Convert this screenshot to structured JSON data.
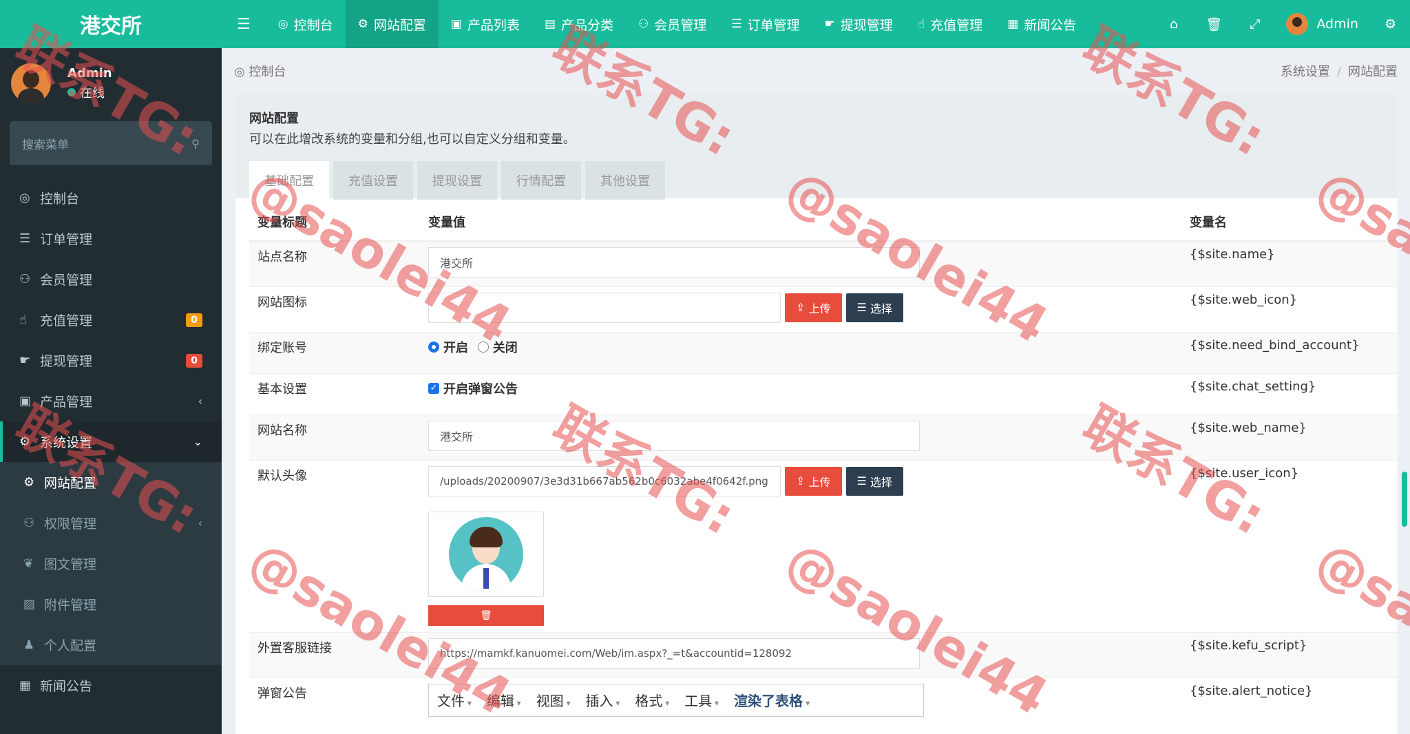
{
  "brand": "港交所",
  "topnav": {
    "items": [
      {
        "icon": "dashboard-icon",
        "glyph": "⚙",
        "label": "控制台"
      },
      {
        "icon": "gear-icon",
        "glyph": "⚙",
        "label": "网站配置"
      },
      {
        "icon": "bag-icon",
        "glyph": "▣",
        "label": "产品列表"
      },
      {
        "icon": "list-icon",
        "glyph": "▤",
        "label": "产品分类"
      },
      {
        "icon": "users-icon",
        "glyph": "⚇",
        "label": "会员管理"
      },
      {
        "icon": "list-icon",
        "glyph": "☰",
        "label": "订单管理"
      },
      {
        "icon": "hand-icon",
        "glyph": "☛",
        "label": "提现管理"
      },
      {
        "icon": "hand-icon",
        "glyph": "☝",
        "label": "充值管理"
      },
      {
        "icon": "news-icon",
        "glyph": "▦",
        "label": "新闻公告"
      }
    ],
    "user": "Admin"
  },
  "sidebar": {
    "user_name": "Admin",
    "user_status": "在线",
    "search_placeholder": "搜索菜单",
    "items": [
      {
        "label": "控制台",
        "glyph": "⚙"
      },
      {
        "label": "订单管理",
        "glyph": "☰"
      },
      {
        "label": "会员管理",
        "glyph": "⚇"
      },
      {
        "label": "充值管理",
        "glyph": "☝",
        "badge": "0"
      },
      {
        "label": "提现管理",
        "glyph": "☛",
        "badge": "0"
      },
      {
        "label": "产品管理",
        "glyph": "▣"
      },
      {
        "label": "系统设置",
        "glyph": "⚙"
      }
    ],
    "submenu": [
      {
        "label": "网站配置",
        "glyph": "⚙"
      },
      {
        "label": "权限管理",
        "glyph": "⚇"
      },
      {
        "label": "图文管理",
        "glyph": "❦"
      },
      {
        "label": "附件管理",
        "glyph": "▨"
      },
      {
        "label": "个人配置",
        "glyph": "♟"
      }
    ],
    "last_item": {
      "label": "新闻公告",
      "glyph": "▦"
    }
  },
  "breadcrumb": {
    "home": "控制台",
    "path": [
      "系统设置",
      "网站配置"
    ]
  },
  "panel": {
    "title": "网站配置",
    "description": "可以在此增改系统的变量和分组,也可以自定义分组和变量。",
    "tabs": [
      "基础配置",
      "充值设置",
      "提现设置",
      "行情配置",
      "其他设置"
    ]
  },
  "table": {
    "headers": [
      "变量标题",
      "变量值",
      "变量名"
    ],
    "rows": {
      "site_name": {
        "title": "站点名称",
        "value": "港交所",
        "var": "{$site.name}"
      },
      "web_icon": {
        "title": "网站图标",
        "value": "",
        "var": "{$site.web_icon}"
      },
      "bind_account": {
        "title": "绑定账号",
        "on": "开启",
        "off": "关闭",
        "var": "{$site.need_bind_account}"
      },
      "chat_setting": {
        "title": "基本设置",
        "check": "开启弹窗公告",
        "var": "{$site.chat_setting}"
      },
      "web_name": {
        "title": "网站名称",
        "value": "港交所",
        "var": "{$site.web_name}"
      },
      "user_icon": {
        "title": "默认头像",
        "value": "/uploads/20200907/3e3d31b667ab562b0c6032abe4f0642f.png",
        "var": "{$site.user_icon}"
      },
      "kefu": {
        "title": "外置客服链接",
        "value": "https://mamkf.kanuomei.com/Web/im.aspx?_=t&accountid=128092",
        "var": "{$site.kefu_script}"
      },
      "alert_notice": {
        "title": "弹窗公告",
        "var": "{$site.alert_notice}"
      }
    },
    "upload_label": "上传",
    "choose_label": "选择"
  },
  "editor_menu": [
    "文件",
    "编辑",
    "视图",
    "插入",
    "格式",
    "工具"
  ],
  "editor_overlay": "渲染了表格",
  "watermark": {
    "line1": "联系TG:",
    "line2": "@saolei44"
  }
}
